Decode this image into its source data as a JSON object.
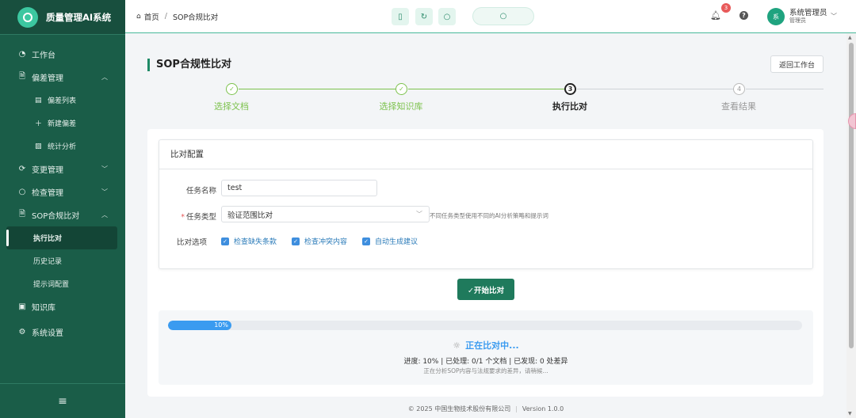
{
  "brand": {
    "title": "质量管理AI系统"
  },
  "sidebar": {
    "items": [
      {
        "label": "工作台",
        "icon": "dashboard-icon"
      },
      {
        "label": "偏差管理",
        "icon": "file-icon",
        "expanded": true
      },
      {
        "label": "偏差列表",
        "sub": true
      },
      {
        "label": "新建偏差",
        "sub": true
      },
      {
        "label": "统计分析",
        "sub": true
      },
      {
        "label": "变更管理",
        "icon": "change-icon"
      },
      {
        "label": "检查管理",
        "icon": "search-icon"
      },
      {
        "label": "SOP合规比对",
        "icon": "file-icon",
        "expanded": true
      },
      {
        "label": "执行比对",
        "sub": true,
        "active": true
      },
      {
        "label": "历史记录",
        "sub": true
      },
      {
        "label": "提示词配置",
        "sub": true
      },
      {
        "label": "知识库",
        "icon": "book-icon"
      },
      {
        "label": "系统设置",
        "icon": "gear-icon"
      }
    ]
  },
  "header": {
    "home": "首页",
    "current": "SOP合规比对",
    "notifications": "3",
    "user_name": "系统管理员",
    "user_role": "管理员",
    "avatar_text": "系"
  },
  "page": {
    "title": "SOP合规性比对",
    "back_label": "返回工作台"
  },
  "steps": [
    {
      "label": "选择文档",
      "status": "done"
    },
    {
      "label": "选择知识库",
      "status": "done"
    },
    {
      "label": "执行比对",
      "status": "active",
      "num": "3"
    },
    {
      "label": "查看结果",
      "status": "pending",
      "num": "4"
    }
  ],
  "config": {
    "title": "比对配置",
    "task_name_label": "任务名称",
    "task_name_value": "test",
    "task_type_label": "任务类型",
    "task_type_value": "验证范围比对",
    "task_type_hint": "不同任务类型使用不同的AI分析策略和提示词",
    "options_label": "比对选项",
    "options": [
      "检查缺失条款",
      "检查冲突内容",
      "自动生成建议"
    ]
  },
  "action": {
    "start_label": "✓开始比对"
  },
  "progress": {
    "percent": 10,
    "percent_label": "10%",
    "status": "正在比对中...",
    "detail": "进度: 10% | 已处理: 0/1 个文档 | 已发现: 0 处差异",
    "sub": "正在分析SOP内容与法规要求的差异，请稍候..."
  },
  "footer": {
    "copyright": "© 2025 中国生物技术股份有限公司",
    "version": "Version 1.0.0"
  },
  "colors": {
    "sidebar": "#1a5d48",
    "accent": "#1f8a66",
    "progress": "#3a9bf0"
  }
}
